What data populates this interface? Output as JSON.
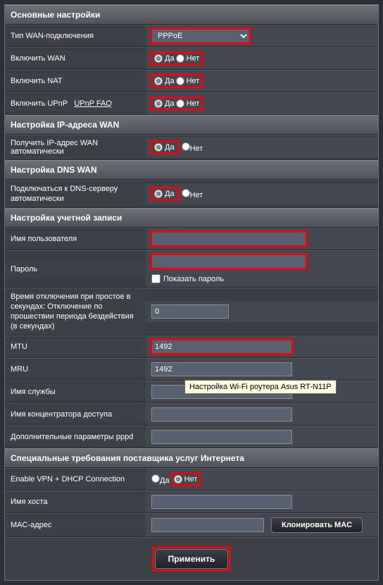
{
  "sections": {
    "basic": "Основные настройки",
    "wanip": "Настройка IP-адреса WAN",
    "dns": "Настройка DNS WAN",
    "acct": "Настройка учетной записи",
    "isp": "Специальные требования поставщика услуг Интернета"
  },
  "labels": {
    "wan_type": "Тип WAN-подключения",
    "enable_wan": "Включить WAN",
    "enable_nat": "Включить NAT",
    "enable_upnp": "Включить UPnP",
    "upnp_faq": "UPnP  FAQ",
    "auto_ip": "Получить IP-адрес WAN автоматически",
    "auto_dns": "Подключаться к DNS-серверу автоматически",
    "username": "Имя пользователя",
    "password": "Пароль",
    "show_password": "Показать пароль",
    "idle": "Время отключения при простое в секундах: Отключение по прошествии периода бездействия (в секундах)",
    "mtu": "MTU",
    "mru": "MRU",
    "service": "Имя службы",
    "concentrator": "Имя концентратора доступа",
    "pppd_extra": "Дополнительные параметры pppd",
    "vpn_dhcp": "Enable VPN + DHCP Connection",
    "hostname": "Имя хоста",
    "mac": "MAC-адрес"
  },
  "options": {
    "yesno": {
      "yes": "Да",
      "no": "Нет"
    }
  },
  "values": {
    "wan_type": "PPPoE",
    "enable_wan": "yes",
    "enable_nat": "yes",
    "enable_upnp": "yes",
    "auto_ip": "yes",
    "auto_dns": "yes",
    "username": "",
    "password": "",
    "show_password": false,
    "idle": "0",
    "mtu": "1492",
    "mru": "1492",
    "service": "",
    "concentrator": "",
    "pppd_extra": "",
    "vpn_dhcp": "no",
    "hostname": "",
    "mac": ""
  },
  "buttons": {
    "clone_mac": "Клонировать MAC",
    "apply": "Применить"
  },
  "tooltip": "Настройка Wi-Fi роутера Asus RT-N11P"
}
